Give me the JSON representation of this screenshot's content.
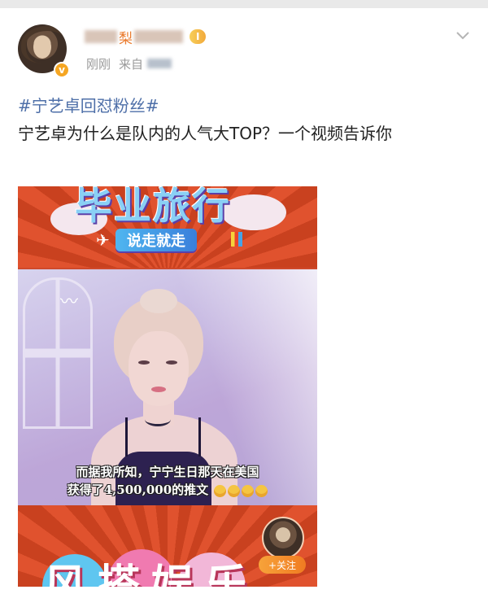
{
  "post": {
    "author": {
      "name_visible": "梨",
      "vip_badge": "I",
      "verified_badge": "v",
      "time": "刚刚",
      "source_prefix": "来自"
    },
    "hashtag": "#宁艺卓回怼粉丝#",
    "text": "宁艺卓为什么是队内的人气大TOP？一个视频告诉你"
  },
  "video": {
    "title_top": "毕业旅行",
    "title_sub": "说走就走",
    "subtitle_line1": "而据我所知，宁宁生日那天在美国",
    "subtitle_line2": "获得了4,500,000的推文",
    "bottom_text": "风搭娱乐",
    "follow_label": "+关注"
  },
  "colors": {
    "hashtag": "#4e6fa8",
    "username": "#ea7a2c",
    "accent_orange": "#f07b22",
    "banner_red": "#cf4a2c"
  },
  "icons": {
    "more": "chevron-down-icon",
    "verified": "verified-v-icon",
    "plane": "airplane-icon",
    "bird": "bird-icon"
  }
}
